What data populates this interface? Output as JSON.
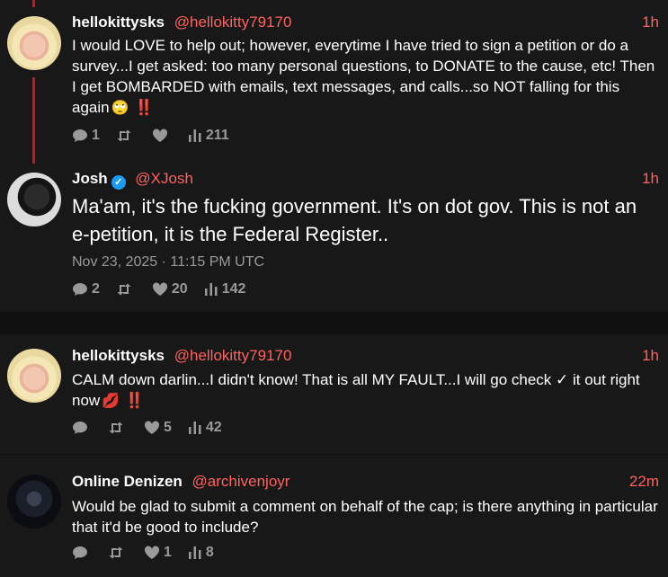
{
  "tweets": [
    {
      "display_name": "hellokittysks",
      "handle": "@hellokitty79170",
      "time": "1h",
      "text": "I would LOVE to help out; however, everytime I have tried to sign a petition or do a survey...I get asked: too many personal questions, to DONATE to the cause, etc! Then I get BOMBARDED with emails, text messages, and calls...so NOT falling for this again",
      "emoji": "🙄",
      "alarm": "‼️",
      "replies": "1",
      "retweets": "",
      "likes": "",
      "views": "211"
    },
    {
      "display_name": "Josh",
      "handle": "@XJosh",
      "time": "1h",
      "verified": true,
      "text": "Ma'am, it's the fucking government. It's on dot gov. This is not an e-petition, it is the Federal Register..",
      "timestamp": "Nov 23, 2025 · 11:15 PM UTC",
      "replies": "2",
      "retweets": "",
      "likes": "20",
      "views": "142"
    },
    {
      "display_name": "hellokittysks",
      "handle": "@hellokitty79170",
      "time": "1h",
      "text": "CALM down darlin...I didn't know! That is all MY FAULT...I will go check ✓ it out right now",
      "emoji": "💋",
      "alarm": "‼️",
      "replies": "",
      "retweets": "",
      "likes": "5",
      "views": "42"
    },
    {
      "display_name": "Online Denizen",
      "handle": "@archivenjoyr",
      "time": "22m",
      "text": "Would be glad to submit a comment on behalf of the cap; is there anything in particular that it'd be good to include?",
      "replies": "",
      "retweets": "",
      "likes": "1",
      "views": "8"
    }
  ],
  "icons": [
    "reply-icon",
    "retweet-icon",
    "like-icon",
    "views-icon",
    "verified-icon"
  ],
  "colors": {
    "background": "#0f0f0f",
    "card": "#181818",
    "accent": "#ff6262",
    "muted": "#9a9a9a",
    "thread_line": "#8e2f33",
    "verified": "#1d9bf0"
  }
}
